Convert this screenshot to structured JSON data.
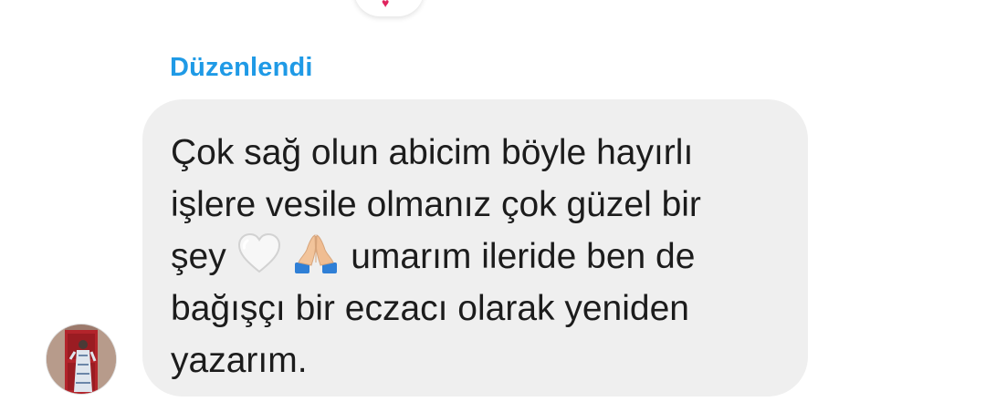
{
  "previous_message": {
    "reaction_icon": "heart-icon",
    "reaction_color": "#e0245e"
  },
  "comment": {
    "edited_label": "Düzenlendi",
    "edited_color": "#1f9ae6",
    "bubble_color": "#efefef",
    "text_line_1": "Çok sağ olun abicim böyle hayırlı",
    "text_line_2": "işlere vesile olmanız çok güzel bir",
    "text_line_3_start": "şey",
    "emoji_1": "white-heart-icon",
    "emoji_2": "praying-hands-icon",
    "text_line_3_end": "umarım ileride ben de",
    "text_line_4": "bağışçı bir eczacı olarak yeniden",
    "text_line_5": "yazarım."
  },
  "sender": {
    "avatar_icon": "avatar"
  }
}
